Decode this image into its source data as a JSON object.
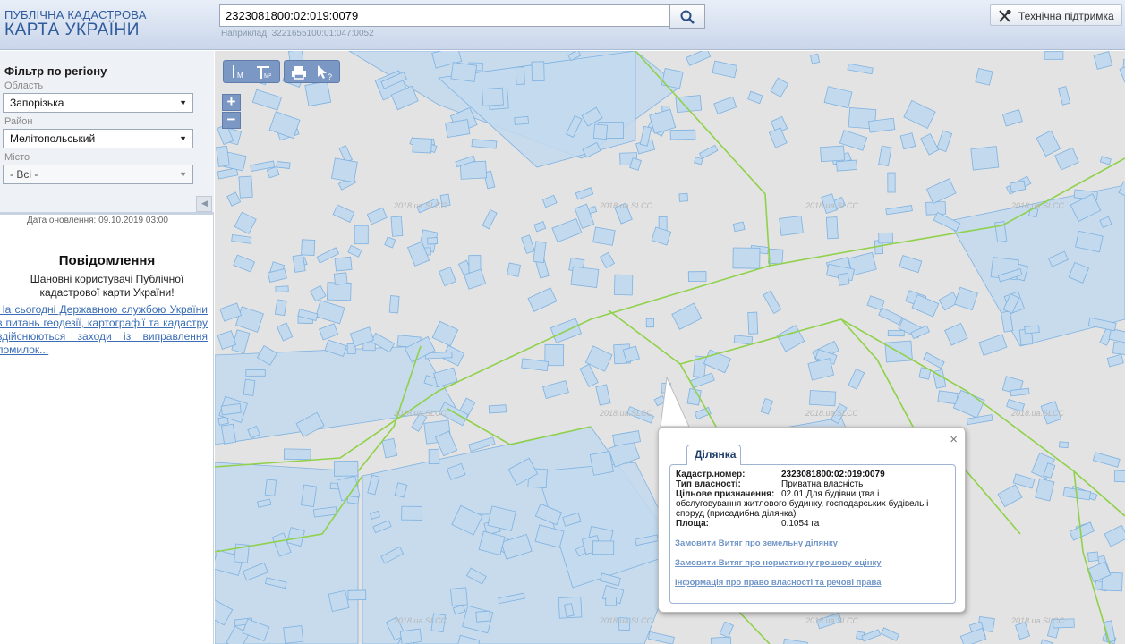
{
  "header": {
    "logo_line1": "ПУБЛІЧНА КАДАСТРОВА",
    "logo_line2": "КАРТА УКРАЇНИ",
    "search_value": "2323081800:02:019:0079",
    "search_hint": "Наприклад: 3221655100:01:047:0052",
    "support_label": "Технічна підтримка"
  },
  "sidebar": {
    "filter_title": "Фільтр по регіону",
    "oblast_label": "Область",
    "oblast_value": "Запорізька",
    "rayon_label": "Район",
    "rayon_value": "Мелітопольський",
    "city_label": "Місто",
    "city_value": "- Всі -",
    "update_date": "Дата оновлення: 09.10.2019 03:00",
    "notice_title": "Повідомлення",
    "notice_text": "Шановні користувачі Публічної кадастрової карти України!",
    "notice_link": "На сьогодні Державною службою України з питань геодезії, картографії та кадастру здійснюються заходи із виправлення помилок..."
  },
  "map": {
    "watermark": "2018.ua.SLCC",
    "tools": [
      "measure-length-icon",
      "measure-area-icon",
      "print-icon",
      "identify-icon"
    ],
    "zoom_in": "+",
    "zoom_out": "−"
  },
  "popup": {
    "tab_label": "Ділянка",
    "close": "×",
    "cadnum_label": "Кадастр.номер:",
    "cadnum_value": "2323081800:02:019:0079",
    "ownership_label": "Тип власності:",
    "ownership_value": "Приватна власність",
    "purpose_label": "Цільове призначення:",
    "purpose_value": "02.01 Для будівництва і",
    "purpose_line2": "обслуговування житлового будинку, господарських будівель і",
    "purpose_line3": "споруд (присадибна ділянка)",
    "area_label": "Площа:",
    "area_value": "0.1054 га",
    "link1": "Замовити Витяг про земельну ділянку",
    "link2": "Замовити Витяг про нормативну грошову оцінку",
    "link3": "Інформація про право власності та речові права"
  },
  "colors": {
    "parcel_fill": "#c2d9ee",
    "parcel_stroke": "#7fb2e0",
    "boundary": "#8fd14a",
    "link": "#3a6db5"
  }
}
